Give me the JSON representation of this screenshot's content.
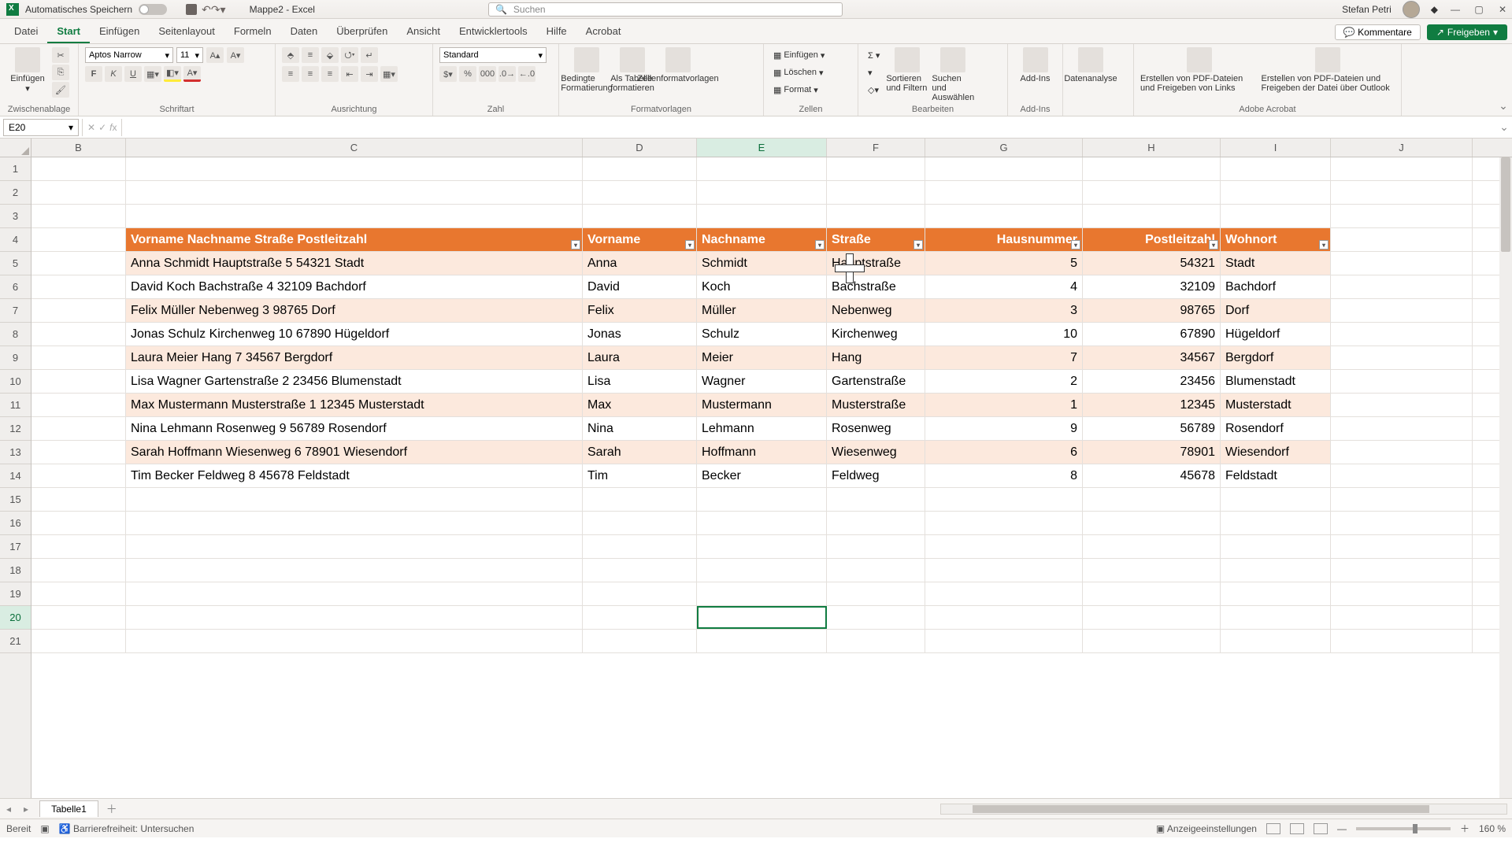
{
  "titlebar": {
    "autosave_label": "Automatisches Speichern",
    "doc_title": "Mappe2 - Excel",
    "search_placeholder": "Suchen",
    "user_name": "Stefan Petri"
  },
  "tabs": {
    "items": [
      "Datei",
      "Start",
      "Einfügen",
      "Seitenlayout",
      "Formeln",
      "Daten",
      "Überprüfen",
      "Ansicht",
      "Entwicklertools",
      "Hilfe",
      "Acrobat"
    ],
    "active_index": 1,
    "comments": "Kommentare",
    "share": "Freigeben"
  },
  "ribbon": {
    "clipboard": {
      "paste": "Einfügen",
      "label": "Zwischenablage"
    },
    "font": {
      "name": "Aptos Narrow",
      "size": "11",
      "label": "Schriftart"
    },
    "align": {
      "label": "Ausrichtung"
    },
    "number": {
      "format": "Standard",
      "label": "Zahl"
    },
    "styles": {
      "cond": "Bedingte Formatierung",
      "astable": "Als Tabelle formatieren",
      "cellstyles": "Zellenformatvorlagen",
      "label": "Formatvorlagen"
    },
    "cells": {
      "insert": "Einfügen",
      "delete": "Löschen",
      "format": "Format",
      "label": "Zellen"
    },
    "editing": {
      "sort": "Sortieren und Filtern",
      "find": "Suchen und Auswählen",
      "label": "Bearbeiten"
    },
    "addins": {
      "addins": "Add-Ins",
      "label": "Add-Ins"
    },
    "analysis": {
      "label": "Datenanalyse"
    },
    "acrobat": {
      "pdf1": "Erstellen von PDF-Dateien und Freigeben von Links",
      "pdf2": "Erstellen von PDF-Dateien und Freigeben der Datei über Outlook",
      "label": "Adobe Acrobat"
    }
  },
  "fbar": {
    "namebox": "E20"
  },
  "columns": [
    "B",
    "C",
    "D",
    "E",
    "F",
    "G",
    "H",
    "I",
    "J"
  ],
  "active_col": "E",
  "active_row": 20,
  "visible_rows": 21,
  "table": {
    "header_row": 4,
    "headers": {
      "C": "Vorname Nachname Straße Postleitzahl",
      "D": "Vorname",
      "E": "Nachname",
      "F": "Straße",
      "G": "Hausnummer",
      "H": "Postleitzahl",
      "I": "Wohnort"
    },
    "rows": [
      {
        "C": "Anna Schmidt Hauptstraße 5 54321 Stadt",
        "D": "Anna",
        "E": "Schmidt",
        "F": "Hauptstraße",
        "G": "5",
        "H": "54321",
        "I": "Stadt"
      },
      {
        "C": "David Koch Bachstraße 4 32109 Bachdorf",
        "D": "David",
        "E": "Koch",
        "F": "Bachstraße",
        "G": "4",
        "H": "32109",
        "I": "Bachdorf"
      },
      {
        "C": "Felix Müller Nebenweg 3 98765 Dorf",
        "D": "Felix",
        "E": "Müller",
        "F": "Nebenweg",
        "G": "3",
        "H": "98765",
        "I": "Dorf"
      },
      {
        "C": "Jonas Schulz Kirchenweg 10 67890 Hügeldorf",
        "D": "Jonas",
        "E": "Schulz",
        "F": "Kirchenweg",
        "G": "10",
        "H": "67890",
        "I": "Hügeldorf"
      },
      {
        "C": "Laura Meier Hang 7 34567 Bergdorf",
        "D": "Laura",
        "E": "Meier",
        "F": "Hang",
        "G": "7",
        "H": "34567",
        "I": "Bergdorf"
      },
      {
        "C": "Lisa Wagner Gartenstraße 2 23456 Blumenstadt",
        "D": "Lisa",
        "E": "Wagner",
        "F": "Gartenstraße",
        "G": "2",
        "H": "23456",
        "I": "Blumenstadt"
      },
      {
        "C": "Max Mustermann Musterstraße 1 12345 Musterstadt",
        "D": "Max",
        "E": "Mustermann",
        "F": "Musterstraße",
        "G": "1",
        "H": "12345",
        "I": "Musterstadt"
      },
      {
        "C": "Nina Lehmann Rosenweg 9 56789 Rosendorf",
        "D": "Nina",
        "E": "Lehmann",
        "F": "Rosenweg",
        "G": "9",
        "H": "56789",
        "I": "Rosendorf"
      },
      {
        "C": "Sarah Hoffmann Wiesenweg 6 78901 Wiesendorf",
        "D": "Sarah",
        "E": "Hoffmann",
        "F": "Wiesenweg",
        "G": "6",
        "H": "78901",
        "I": "Wiesendorf"
      },
      {
        "C": "Tim Becker Feldweg 8 45678 Feldstadt",
        "D": "Tim",
        "E": "Becker",
        "F": "Feldweg",
        "G": "8",
        "H": "45678",
        "I": "Feldstadt"
      }
    ]
  },
  "sheet": {
    "name": "Tabelle1"
  },
  "status": {
    "ready": "Bereit",
    "accessibility": "Barrierefreiheit: Untersuchen",
    "display": "Anzeigeeinstellungen",
    "zoom": "160 %"
  },
  "colors": {
    "table_header": "#e8772f",
    "band": "#fce9dd",
    "accent": "#107c41"
  }
}
